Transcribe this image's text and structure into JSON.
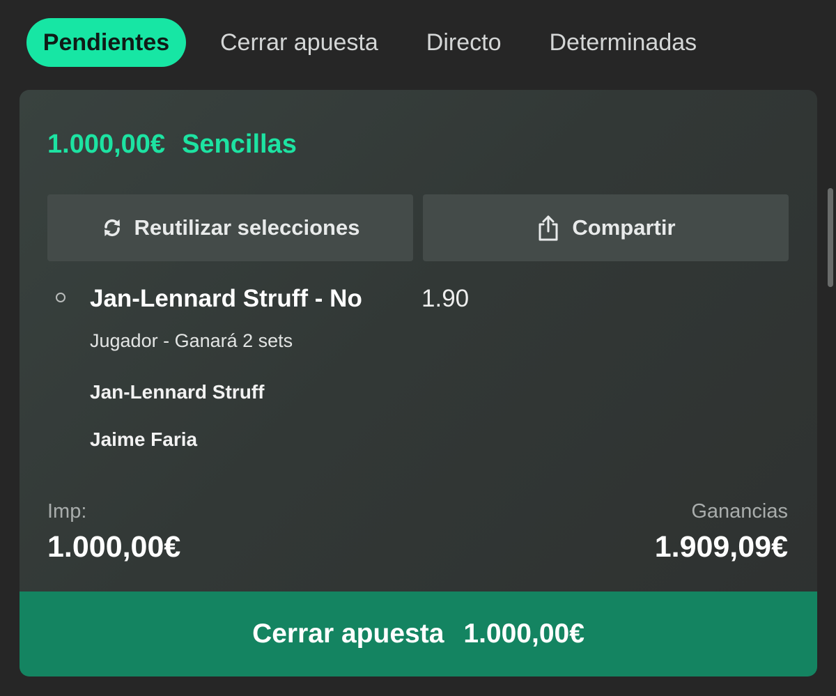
{
  "tabs": [
    {
      "label": "Pendientes",
      "active": true
    },
    {
      "label": "Cerrar apuesta",
      "active": false
    },
    {
      "label": "Directo",
      "active": false
    },
    {
      "label": "Determinadas",
      "active": false
    }
  ],
  "bet": {
    "amount": "1.000,00€",
    "type": "Sencillas"
  },
  "actions": {
    "reuse_label": "Reutilizar selecciones",
    "reuse_icon": "refresh-icon",
    "share_label": "Compartir",
    "share_icon": "share-icon"
  },
  "selection": {
    "title": "Jan-Lennard Struff - No",
    "odds": "1.90",
    "market": "Jugador - Ganará 2 sets",
    "players": [
      "Jan-Lennard Struff",
      "Jaime Faria"
    ]
  },
  "summary": {
    "stake_label": "Imp:",
    "stake_value": "1.000,00€",
    "winnings_label": "Ganancias",
    "winnings_value": "1.909,09€"
  },
  "cashout": {
    "label": "Cerrar apuesta",
    "amount": "1.000,00€"
  },
  "colors": {
    "accent": "#17e6a4",
    "cashout_bg": "#148461",
    "card_bg": "#333937",
    "page_bg": "#262626"
  }
}
